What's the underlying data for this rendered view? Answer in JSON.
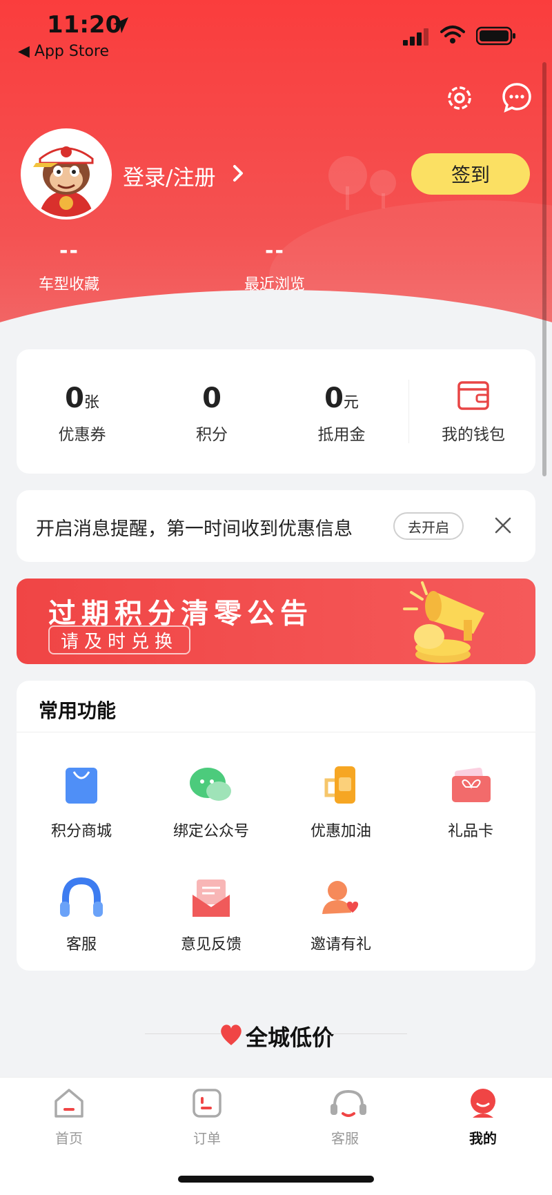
{
  "status_bar": {
    "time": "11:20",
    "back_label": "◀ App Store"
  },
  "profile": {
    "login_label": "登录/注册",
    "signin_label": "签到",
    "stats": [
      {
        "value": "--",
        "label": "车型收藏"
      },
      {
        "value": "--",
        "label": "最近浏览"
      }
    ]
  },
  "wallet": {
    "items": [
      {
        "value": "0",
        "unit": "张",
        "label": "优惠券"
      },
      {
        "value": "0",
        "unit": "",
        "label": "积分"
      },
      {
        "value": "0",
        "unit": "元",
        "label": "抵用金"
      }
    ],
    "my_wallet_label": "我的钱包"
  },
  "notice": {
    "text": "开启消息提醒，第一时间收到优惠信息",
    "button_label": "去开启"
  },
  "banner": {
    "title": "过期积分清零公告",
    "subtitle": "请及时兑换"
  },
  "functions": {
    "title": "常用功能",
    "items": [
      {
        "label": "积分商城",
        "icon": "shopping-bag-icon"
      },
      {
        "label": "绑定公众号",
        "icon": "wechat-icon"
      },
      {
        "label": "优惠加油",
        "icon": "fuel-cup-icon"
      },
      {
        "label": "礼品卡",
        "icon": "gift-card-icon"
      },
      {
        "label": "客服",
        "icon": "headphones-icon"
      },
      {
        "label": "意见反馈",
        "icon": "feedback-envelope-icon"
      },
      {
        "label": "邀请有礼",
        "icon": "invite-user-icon"
      }
    ]
  },
  "city": {
    "title": "全城低价"
  },
  "tabbar": {
    "tabs": [
      {
        "label": "首页",
        "icon": "home-icon"
      },
      {
        "label": "订单",
        "icon": "order-icon"
      },
      {
        "label": "客服",
        "icon": "service-headset-icon"
      },
      {
        "label": "我的",
        "icon": "profile-icon"
      }
    ],
    "active_index": 3
  },
  "colors": {
    "header_red": "#fa3d3d",
    "signin_yellow": "#fbe063",
    "banner_red": "#f04545"
  }
}
